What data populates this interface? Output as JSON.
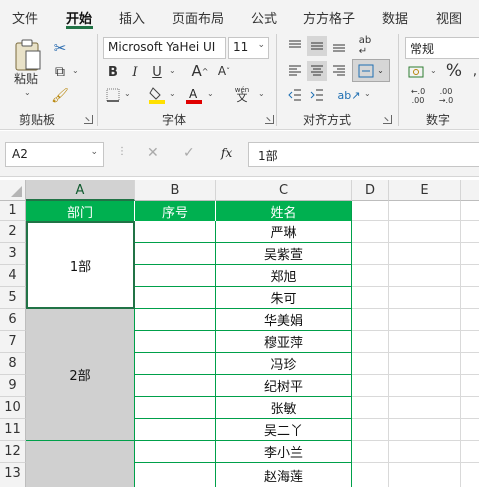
{
  "tabs": [
    "文件",
    "开始",
    "插入",
    "页面布局",
    "公式",
    "方方格子",
    "数据",
    "视图"
  ],
  "active_tab": "开始",
  "ribbon": {
    "clipboard": {
      "paste_label": "粘贴",
      "group_label": "剪贴板"
    },
    "font": {
      "font_name": "Microsoft YaHei UI",
      "font_size": "11",
      "group_label": "字体",
      "bold": "B",
      "italic": "I",
      "underline": "U",
      "font_color": "#e00000",
      "fill_color": "#ffe000",
      "phonetic": "wén"
    },
    "alignment": {
      "group_label": "对齐方式"
    },
    "number": {
      "format": "常规",
      "group_label": "数字",
      "percent": "%"
    }
  },
  "formula_bar": {
    "name_box": "A2",
    "fx": "fx",
    "formula": "1部"
  },
  "columns": [
    "A",
    "B",
    "C",
    "D",
    "E"
  ],
  "rows": [
    "1",
    "2",
    "3",
    "4",
    "5",
    "6",
    "7",
    "8",
    "9",
    "10",
    "11",
    "12",
    "13"
  ],
  "sheet": {
    "header": {
      "a": "部门",
      "b": "序号",
      "c": "姓名"
    },
    "groups": [
      "1部",
      "2部",
      ""
    ],
    "names": [
      "严琳",
      "吴紫萱",
      "郑旭",
      "朱可",
      "华美娟",
      "穆亚萍",
      "冯珍",
      "纪树平",
      "张敏",
      "吴二丫",
      "李小兰",
      "赵海莲"
    ]
  }
}
